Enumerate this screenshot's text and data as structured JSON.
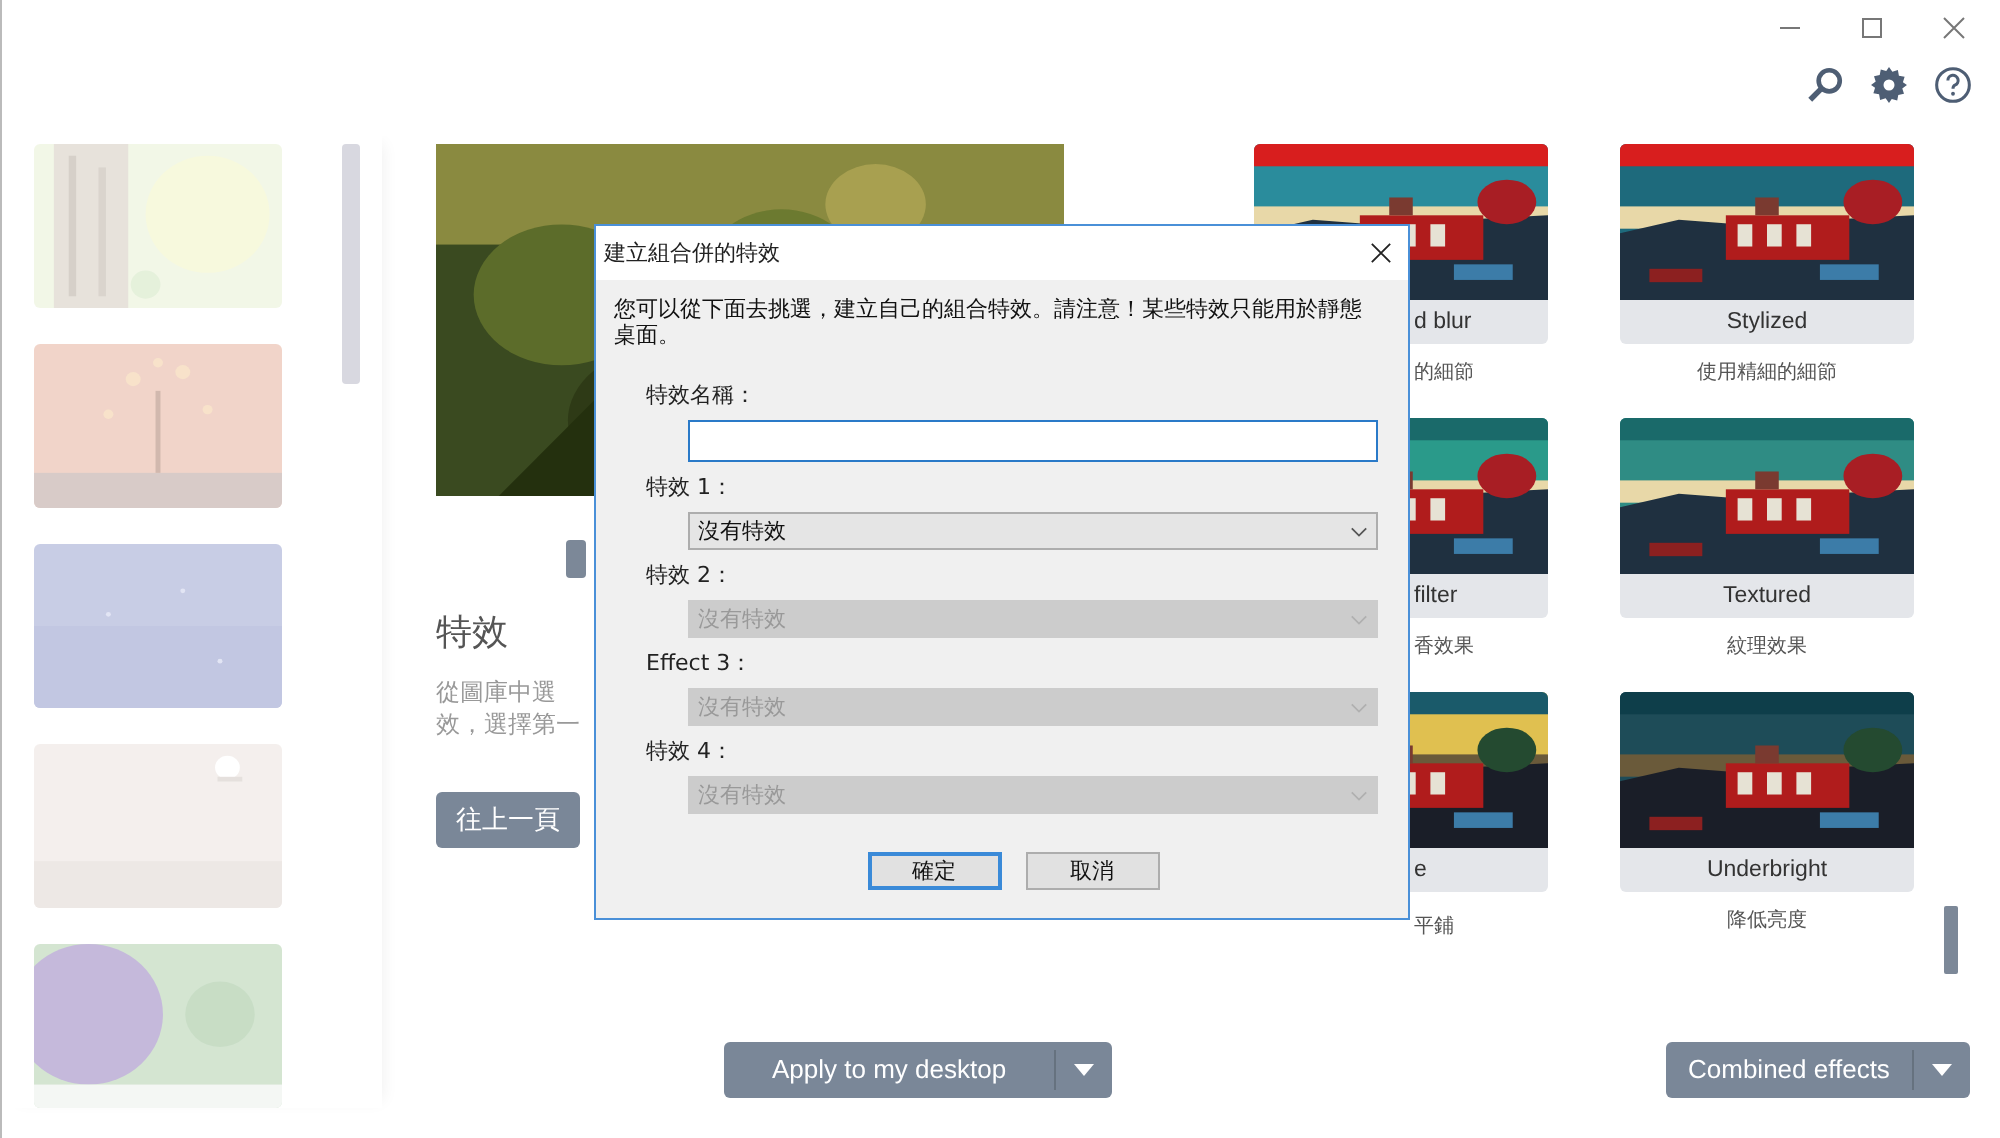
{
  "center": {
    "heading": "特效",
    "description_lines": [
      "從圖庫中選",
      "效，選擇第一"
    ],
    "back_button": "往上一頁"
  },
  "effects": [
    {
      "kind": "covered",
      "label": "d blur",
      "caption": "的細節"
    },
    {
      "kind": "full",
      "label": "Stylized",
      "caption": "使用精細的細節"
    },
    {
      "kind": "covered",
      "label": "filter",
      "caption": "香效果"
    },
    {
      "kind": "full",
      "label": "Textured",
      "caption": "紋理效果"
    },
    {
      "kind": "covered",
      "label": "e",
      "caption": "平鋪"
    },
    {
      "kind": "full",
      "label": "Underbright",
      "caption": "降低亮度"
    }
  ],
  "apply_button": "Apply to my desktop",
  "combined_button": "Combined effects",
  "dialog": {
    "title": "建立組合併的特效",
    "intro": "您可以從下面去挑選，建立自己的組合特效。請注意！某些特效只能用於靜態桌面。",
    "name_label": "特效名稱：",
    "effects": [
      {
        "label": "特效 1：",
        "value": "沒有特效",
        "disabled": false
      },
      {
        "label": "特效 2：",
        "value": "沒有特效",
        "disabled": true
      },
      {
        "label": "Effect 3：",
        "value": "沒有特效",
        "disabled": true
      },
      {
        "label": "特效 4：",
        "value": "沒有特效",
        "disabled": true
      }
    ],
    "buttons": [
      {
        "label": "確定",
        "default": true
      },
      {
        "label": "取消",
        "default": false
      }
    ]
  }
}
